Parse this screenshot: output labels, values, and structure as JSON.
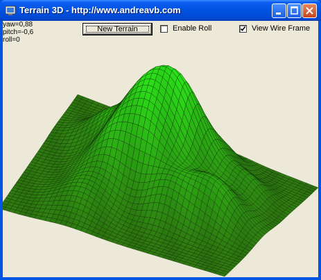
{
  "window": {
    "title": "Terrain 3D - http://www.andreavb.com",
    "icons": [
      "app-icon",
      "minimize-icon",
      "maximize-icon",
      "close-icon"
    ]
  },
  "readout": {
    "yaw": "yaw=0,88",
    "pitch": "pitch=-0,6",
    "roll": "roll=0"
  },
  "controls": {
    "new_terrain_label": "New Terrain",
    "enable_roll_label": "Enable Roll",
    "enable_roll_checked": false,
    "wire_frame_label": "View Wire Frame",
    "wire_frame_checked": true
  },
  "colors": {
    "terrain_base": "#2f7a10",
    "terrain_peak": "#2be81a",
    "wire": "#0b2a04",
    "background": "#ece9d8"
  }
}
